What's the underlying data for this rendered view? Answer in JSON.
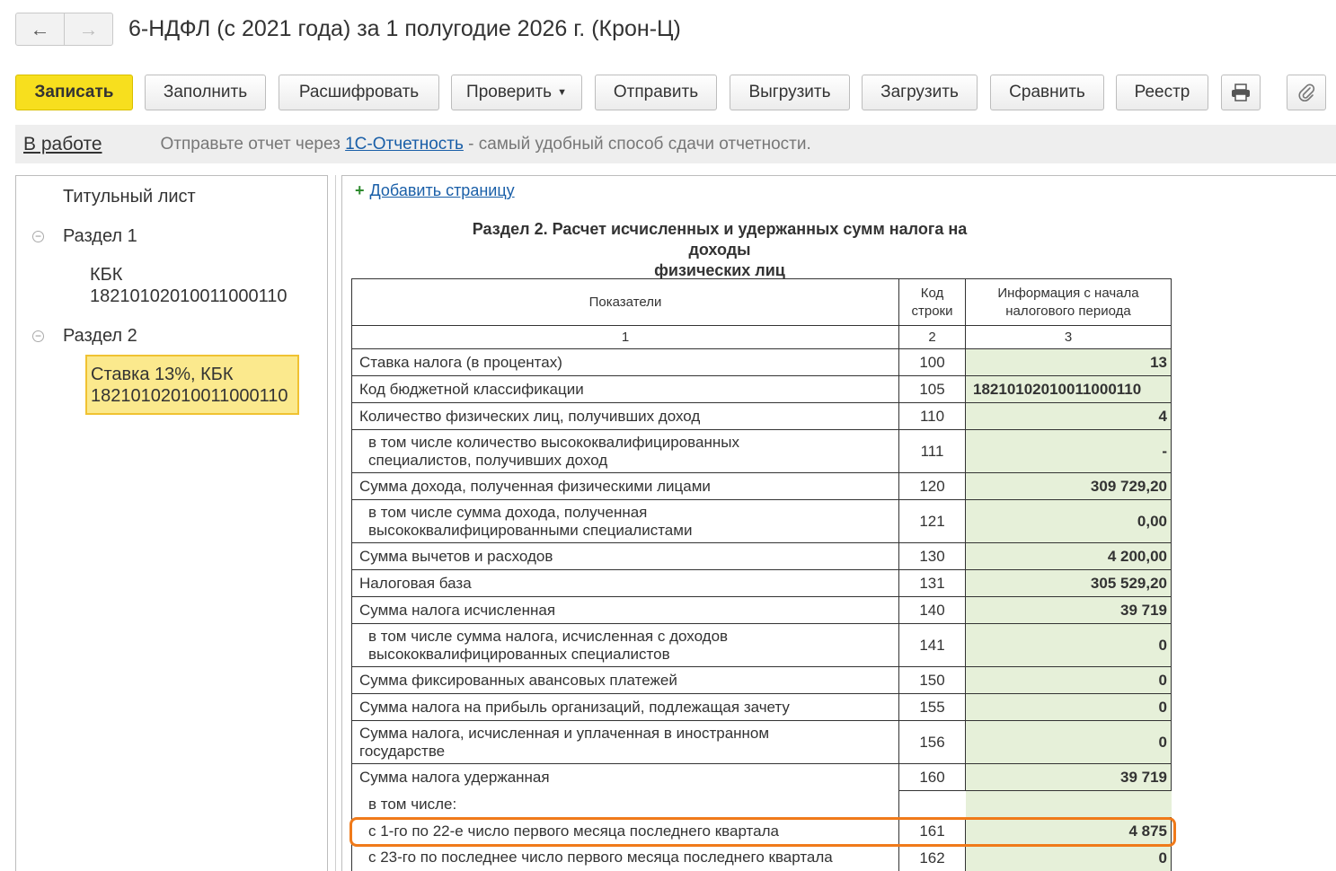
{
  "window": {
    "back_icon": "arrow-left-icon",
    "forward_icon": "arrow-right-icon",
    "title": "6-НДФЛ (с 2021 года) за 1 полугодие 2026 г. (Крон-Ц)"
  },
  "toolbar": {
    "save": "Записать",
    "fill": "Заполнить",
    "decode": "Расшифровать",
    "check": "Проверить",
    "send": "Отправить",
    "export": "Выгрузить",
    "import": "Загрузить",
    "compare": "Сравнить",
    "registry": "Реестр",
    "print_icon": "printer-icon",
    "attach_icon": "paperclip-icon"
  },
  "status": {
    "state": "В работе",
    "msg_before": "Отправьте отчет через ",
    "msg_link": "1С-Отчетность",
    "msg_after": " - самый удобный способ сдачи отчетности."
  },
  "tree": {
    "title_page": "Титульный лист",
    "section1": "Раздел 1",
    "section1_child_line1": "КБК",
    "section1_child_line2": "18210102010011000110",
    "section2": "Раздел 2",
    "section2_child_line1": "Ставка 13%, КБК",
    "section2_child_line2": "18210102010011000110"
  },
  "report": {
    "add_page": "Добавить страницу",
    "heading_line1": "Раздел 2. Расчет исчисленных и удержанных сумм налога на доходы",
    "heading_line2": "физических лиц",
    "col_headers": {
      "indicators": "Показатели",
      "code_line1": "Код",
      "code_line2": "строки",
      "info_line1": "Информация с начала",
      "info_line2": "налогового периода"
    },
    "col_numbers": [
      "1",
      "2",
      "3"
    ],
    "rows": [
      {
        "label": "Ставка налога (в процентах)",
        "code": "100",
        "value": "13"
      },
      {
        "label": "Код бюджетной классификации",
        "code": "105",
        "value": "18210102010011000110"
      },
      {
        "label": "Количество физических лиц, получивших доход",
        "code": "110",
        "value": "4"
      },
      {
        "label_line1": "в том числе количество высококвалифицированных",
        "label_line2": "специалистов, получивших доход",
        "code": "111",
        "value": "-"
      },
      {
        "label": "Сумма дохода, полученная физическими лицами",
        "code": "120",
        "value": "309 729,20"
      },
      {
        "label_line1": "в том числе сумма дохода, полученная",
        "label_line2": "высококвалифицированными специалистами",
        "code": "121",
        "value": "0,00"
      },
      {
        "label": "Сумма вычетов и расходов",
        "code": "130",
        "value": "4 200,00"
      },
      {
        "label": "Налоговая база",
        "code": "131",
        "value": "305 529,20"
      },
      {
        "label": "Сумма налога исчисленная",
        "code": "140",
        "value": "39 719"
      },
      {
        "label_line1": "в том числе сумма налога, исчисленная с доходов",
        "label_line2": "высококвалифицированных специалистов",
        "code": "141",
        "value": "0"
      },
      {
        "label": "Сумма фиксированных авансовых платежей",
        "code": "150",
        "value": "0"
      },
      {
        "label": "Сумма налога на прибыль организаций, подлежащая зачету",
        "code": "155",
        "value": "0"
      },
      {
        "label_line1": "Сумма налога, исчисленная и уплаченная в иностранном",
        "label_line2": "государстве",
        "code": "156",
        "value": "0"
      },
      {
        "label": "Сумма налога удержанная",
        "code": "160",
        "value": "39 719"
      },
      {
        "label": "в том числе:"
      },
      {
        "label": "с 1-го по 22-е число первого месяца последнего квартала",
        "code": "161",
        "value": "4 875"
      },
      {
        "label": "с 23-го по последнее число первого месяца последнего квартала",
        "code": "162",
        "value": "0"
      }
    ]
  }
}
